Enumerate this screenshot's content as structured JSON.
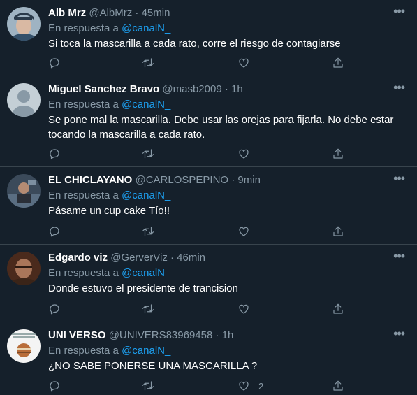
{
  "reply_prefix": "En respuesta a",
  "more_glyph": "•••",
  "colors": {
    "background": "#15202b",
    "muted": "#8899a6",
    "link": "#1da1f2",
    "divider": "#38444d"
  },
  "icons": [
    "reply-icon",
    "retweet-icon",
    "like-icon",
    "share-icon",
    "more-icon"
  ],
  "tweets": [
    {
      "name": "Alb Mrz",
      "handle": "@AlbMrz",
      "time": "45min",
      "reply_to": "@canalN_",
      "text": "Si toca la mascarilla a cada rato, corre el riesgo de contagiarse",
      "like_count": ""
    },
    {
      "name": "Miguel Sanchez Bravo",
      "handle": "@masb2009",
      "time": "1h",
      "reply_to": "@canalN_",
      "text": "Se pone mal la mascarilla. Debe usar las orejas para fijarla. No debe estar tocando la mascarilla a cada rato.",
      "like_count": ""
    },
    {
      "name": "EL CHICLAYANO",
      "handle": "@CARLOSPEPINO",
      "time": "9min",
      "reply_to": "@canalN_",
      "text": "Pásame un cup cake Tío!!",
      "like_count": ""
    },
    {
      "name": "Edgardo viz",
      "handle": "@GerverViz",
      "time": "46min",
      "reply_to": "@canalN_",
      "text": "Donde estuvo el presidente de trancision",
      "like_count": ""
    },
    {
      "name": "UNI VERSO",
      "handle": "@UNIVERS83969458",
      "time": "1h",
      "reply_to": "@canalN_",
      "text": "¿NO SABE PONERSE UNA MASCARILLA ?",
      "like_count": "2"
    }
  ]
}
